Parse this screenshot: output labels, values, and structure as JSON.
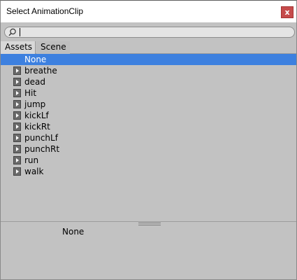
{
  "window": {
    "title": "Select AnimationClip",
    "close_label": "x"
  },
  "search": {
    "value": "",
    "icon": "search-icon"
  },
  "tabs": [
    {
      "label": "Assets",
      "active": true
    },
    {
      "label": "Scene",
      "active": false
    }
  ],
  "list": {
    "items": [
      {
        "label": "None",
        "selected": true,
        "icon": null
      },
      {
        "label": "breathe",
        "selected": false,
        "icon": "animation-clip-icon"
      },
      {
        "label": "dead",
        "selected": false,
        "icon": "animation-clip-icon"
      },
      {
        "label": "Hit",
        "selected": false,
        "icon": "animation-clip-icon"
      },
      {
        "label": "jump",
        "selected": false,
        "icon": "animation-clip-icon"
      },
      {
        "label": "kickLf",
        "selected": false,
        "icon": "animation-clip-icon"
      },
      {
        "label": "kickRt",
        "selected": false,
        "icon": "animation-clip-icon"
      },
      {
        "label": "punchLf",
        "selected": false,
        "icon": "animation-clip-icon"
      },
      {
        "label": "punchRt",
        "selected": false,
        "icon": "animation-clip-icon"
      },
      {
        "label": "run",
        "selected": false,
        "icon": "animation-clip-icon"
      },
      {
        "label": "walk",
        "selected": false,
        "icon": "animation-clip-icon"
      }
    ]
  },
  "preview": {
    "label": "None"
  },
  "colors": {
    "selection": "#3d80df",
    "close_button": "#c64b4b",
    "panel_bg": "#c2c2c2"
  }
}
